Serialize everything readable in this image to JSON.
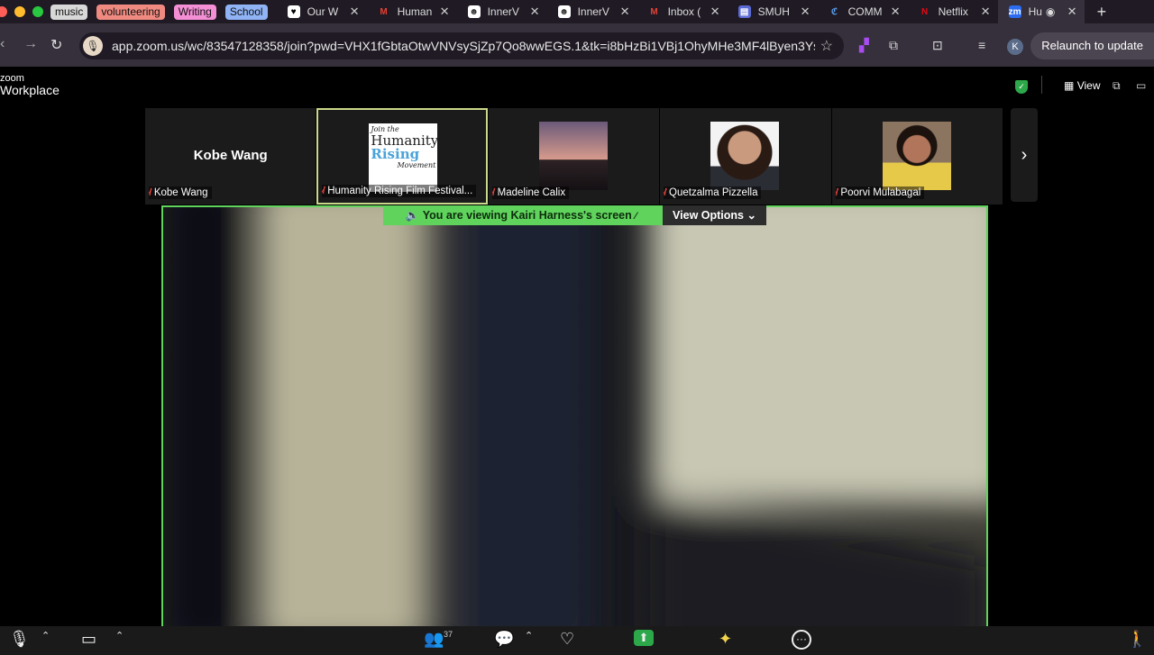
{
  "browser": {
    "tab_groups": [
      {
        "label": "music",
        "color": "#d8d8d8"
      },
      {
        "label": "volunteering",
        "color": "#f08a80"
      },
      {
        "label": "Writing",
        "color": "#f48fd6"
      },
      {
        "label": "School",
        "color": "#8fb3f5"
      }
    ],
    "tabs": [
      {
        "title": "Our W",
        "icon": "heart-icon"
      },
      {
        "title": "Human",
        "icon": "gmail-icon"
      },
      {
        "title": "InnerV",
        "icon": "innerv-icon"
      },
      {
        "title": "InnerV",
        "icon": "innerv-icon"
      },
      {
        "title": "Inbox (",
        "icon": "gmail-icon"
      },
      {
        "title": "SMUH",
        "icon": "forms-icon"
      },
      {
        "title": "COMM",
        "icon": "canvas-icon"
      },
      {
        "title": "Netflix",
        "icon": "netflix-icon"
      },
      {
        "title": "Hu",
        "icon": "zoom-icon"
      }
    ],
    "url": "app.zoom.us/wc/83547128358/join?pwd=VHX1fGbtaOtwVNVsySjZp7Qo8wwEGS.1&tk=i8bHzBi1VBj1OhyMHe3MF4lByen3Ysk...",
    "profile_initial": "K",
    "relaunch_label": "Relaunch to update"
  },
  "zoom": {
    "logo_small": "zoom",
    "logo_big": "Workplace",
    "view_label": "View"
  },
  "participants": [
    {
      "name": "Kobe Wang",
      "show_big_name": true,
      "active": false
    },
    {
      "name": "Humanity Rising Film Festival...",
      "show_big_name": false,
      "active": true,
      "thumb": "logo"
    },
    {
      "name": "Madeline Calix",
      "show_big_name": false,
      "active": false,
      "thumb": "sunset"
    },
    {
      "name": "Quetzalma Pizzella",
      "show_big_name": false,
      "active": false,
      "thumb": "portrait"
    },
    {
      "name": "Poorvi Mulabagal",
      "show_big_name": false,
      "active": false,
      "thumb": "child"
    }
  ],
  "thumb_logo_lines": [
    "Join the",
    "Humanity",
    "Rising",
    "Movement"
  ],
  "share": {
    "banner": "You are viewing  Kairi Harness's screen",
    "view_options": "View Options"
  },
  "bottom": {
    "participants_count": "37"
  }
}
